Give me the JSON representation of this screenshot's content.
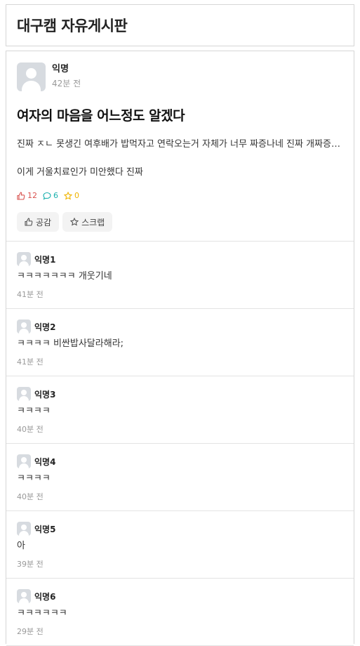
{
  "board": {
    "title": "대구캠 자유게시판"
  },
  "post": {
    "author": "익명",
    "time": "42분 전",
    "title": "여자의 마음을 어느정도 알겠다",
    "body_lines": [
      "진짜 ㅈㄴ 못생긴 여후배가 밥먹자고 연락오는거 자체가 너무 짜증나네 진짜 개짜증나는데",
      "이게 거울치료인가 미안했다 진짜"
    ],
    "stats": {
      "likes": "12",
      "comments": "6",
      "scraps": "0"
    },
    "actions": {
      "like_label": "공감",
      "scrap_label": "스크랩"
    }
  },
  "comments": [
    {
      "author": "익명1",
      "text": "ㅋㅋㅋㅋㅋㅋㅋ 개웃기네",
      "time": "41분 전"
    },
    {
      "author": "익명2",
      "text": "ㅋㅋㅋㅋ 비싼밥사달라해라;",
      "time": "41분 전"
    },
    {
      "author": "익명3",
      "text": "ㅋㅋㅋㅋ",
      "time": "40분 전"
    },
    {
      "author": "익명4",
      "text": "ㅋㅋㅋㅋ",
      "time": "40분 전"
    },
    {
      "author": "익명5",
      "text": "아",
      "time": "39분 전"
    },
    {
      "author": "익명6",
      "text": "ㅋㅋㅋㅋㅋㅋ",
      "time": "29분 전"
    }
  ],
  "colors": {
    "like": "#d9534f",
    "comment": "#1ab0ad",
    "scrap": "#f0b400"
  },
  "icons": {
    "like": "thumbs-up-icon",
    "comment": "speech-bubble-icon",
    "scrap": "star-icon",
    "avatar": "default-avatar-icon"
  }
}
